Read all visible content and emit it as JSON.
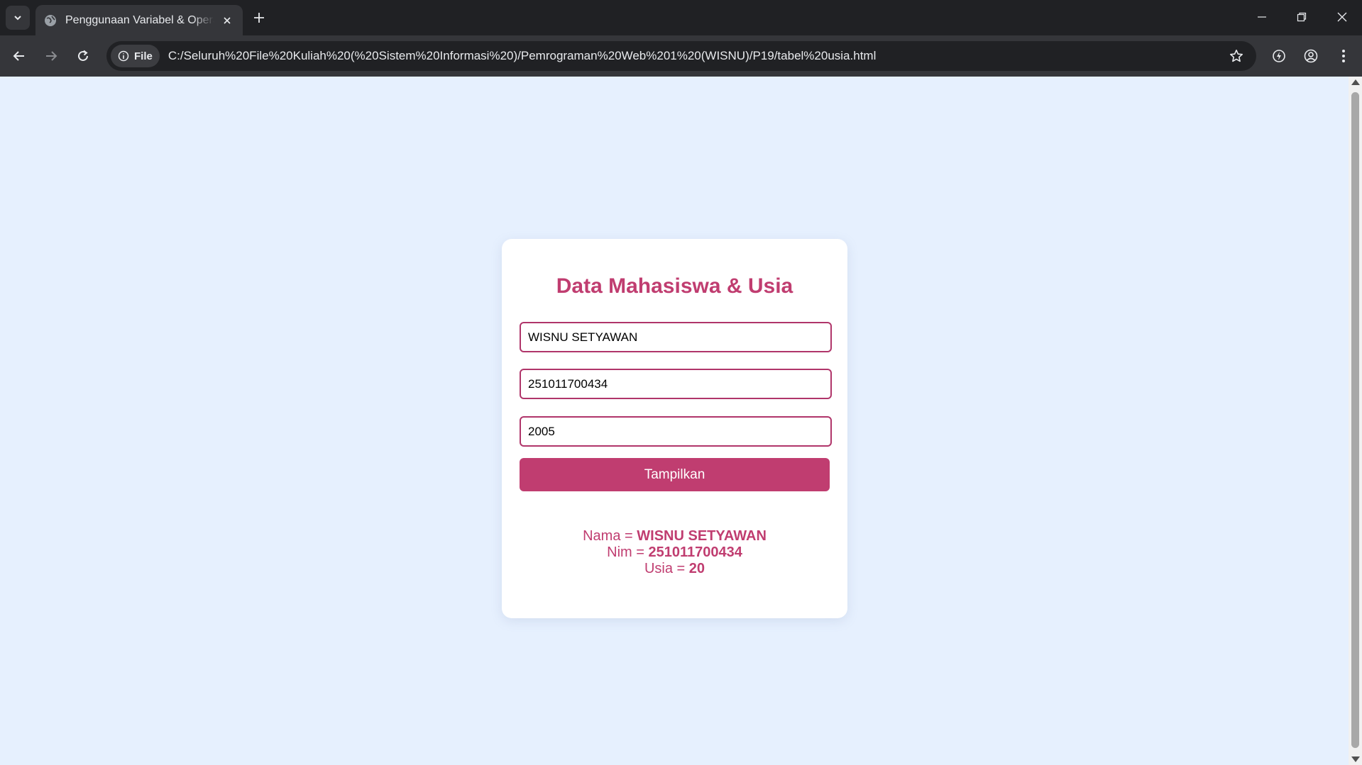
{
  "browser": {
    "tab_title": "Penggunaan Variabel & Operator",
    "site_chip_label": "File",
    "url": "C:/Seluruh%20File%20Kuliah%20(%20Sistem%20Informasi%20)/Pemrograman%20Web%201%20(WISNU)/P19/tabel%20usia.html"
  },
  "form": {
    "title": "Data Mahasiswa & Usia",
    "nama_value": "WISNU SETYAWAN",
    "nim_value": "251011700434",
    "tahun_value": "2005",
    "button_label": "Tampilkan"
  },
  "result": {
    "nama_label": "Nama = ",
    "nama_value": "WISNU SETYAWAN",
    "nim_label": "Nim = ",
    "nim_value": "251011700434",
    "usia_label": "Usia = ",
    "usia_value": "20"
  },
  "colors": {
    "accent": "#c03d70",
    "page_background": "#e6f0fe",
    "card_background": "#ffffff"
  },
  "icons": [
    "tab-list-icon",
    "globe-icon",
    "close-icon",
    "plus-icon",
    "minimize-icon",
    "restore-icon",
    "window-close-icon",
    "back-icon",
    "forward-icon",
    "reload-icon",
    "info-icon",
    "star-icon",
    "performance-icon",
    "profile-icon",
    "menu-icon"
  ]
}
